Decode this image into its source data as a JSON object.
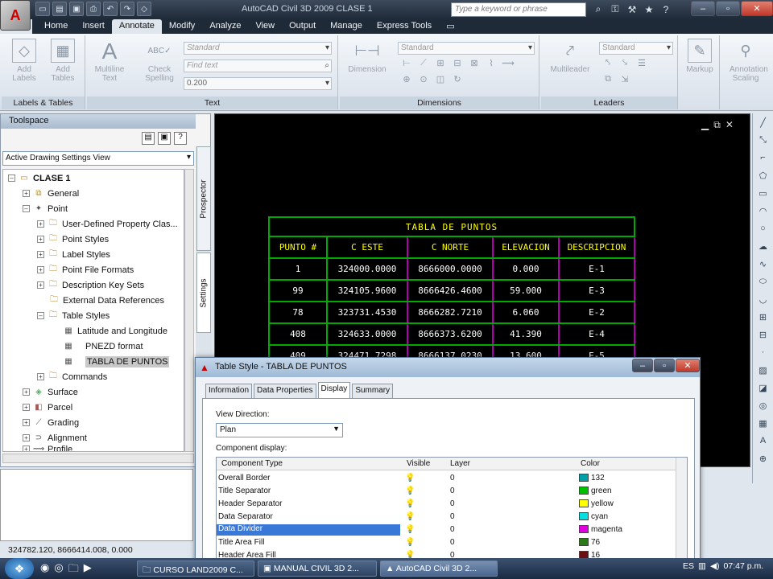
{
  "window": {
    "title": "AutoCAD Civil 3D 2009    CLASE 1",
    "search_placeholder": "Type a keyword or phrase"
  },
  "ribbon": {
    "tabs": [
      "Home",
      "Insert",
      "Annotate",
      "Modify",
      "Analyze",
      "View",
      "Output",
      "Manage",
      "Express Tools"
    ],
    "active_tab": "Annotate",
    "panels": {
      "labels": {
        "title": "Labels & Tables",
        "add_labels": "Add Labels",
        "add_tables": "Add Tables"
      },
      "text": {
        "title": "Text",
        "multiline": "Multiline Text",
        "check_spelling": "Check Spelling",
        "style": "Standard",
        "find_text": "Find text",
        "height": "0.200"
      },
      "dimensions": {
        "title": "Dimensions",
        "dimension": "Dimension",
        "style": "Standard"
      },
      "leaders": {
        "title": "Leaders",
        "multileader": "Multileader",
        "style": "Standard"
      },
      "markup": {
        "title": "Markup"
      },
      "scaling": {
        "title": "Annotation Scaling"
      }
    }
  },
  "toolspace": {
    "title": "Toolspace",
    "view": "Active Drawing Settings View",
    "vtabs": [
      "Prospector",
      "Settings"
    ],
    "tree": [
      {
        "label": "CLASE 1",
        "level": 0
      },
      {
        "label": "General",
        "level": 1
      },
      {
        "label": "Point",
        "level": 1
      },
      {
        "label": "User-Defined Property Clas...",
        "level": 2
      },
      {
        "label": "Point Styles",
        "level": 2
      },
      {
        "label": "Label Styles",
        "level": 2
      },
      {
        "label": "Point File Formats",
        "level": 2
      },
      {
        "label": "Description Key Sets",
        "level": 2
      },
      {
        "label": "External Data References",
        "level": 2
      },
      {
        "label": "Table Styles",
        "level": 2
      },
      {
        "label": "Latitude and Longitude",
        "level": 3
      },
      {
        "label": "PNEZD format",
        "level": 3
      },
      {
        "label": "TABLA DE PUNTOS",
        "level": 3
      },
      {
        "label": "Commands",
        "level": 2
      },
      {
        "label": "Surface",
        "level": 1
      },
      {
        "label": "Parcel",
        "level": 1
      },
      {
        "label": "Grading",
        "level": 1
      },
      {
        "label": "Alignment",
        "level": 1
      },
      {
        "label": "Profile",
        "level": 1
      }
    ]
  },
  "points_table": {
    "title": "TABLA DE PUNTOS",
    "headers": [
      "PUNTO #",
      "C ESTE",
      "C NORTE",
      "ELEVACION",
      "DESCRIPCION"
    ],
    "rows": [
      [
        "1",
        "324000.0000",
        "8666000.0000",
        "0.000",
        "E-1"
      ],
      [
        "99",
        "324105.9600",
        "8666426.4600",
        "59.000",
        "E-3"
      ],
      [
        "78",
        "323731.4530",
        "8666282.7210",
        "6.060",
        "E-2"
      ],
      [
        "408",
        "324633.0000",
        "8666373.6200",
        "41.390",
        "E-4"
      ],
      [
        "409",
        "324471.7298",
        "8666137.0230",
        "13.600",
        "E-5"
      ]
    ]
  },
  "status": {
    "coords": "324782.120, 8666414.008, 0.000"
  },
  "dialog": {
    "title": "Table Style - TABLA DE PUNTOS",
    "tabs": [
      "Information",
      "Data Properties",
      "Display",
      "Summary"
    ],
    "active_tab": "Display",
    "view_direction_label": "View Direction:",
    "view_direction": "Plan",
    "component_display_label": "Component display:",
    "columns": [
      "Component Type",
      "Visible",
      "Layer",
      "Color"
    ],
    "rows": [
      {
        "type": "Overall Border",
        "layer": "0",
        "color": "132",
        "swatch": "#00a0a8"
      },
      {
        "type": "Title Separator",
        "layer": "0",
        "color": "green",
        "swatch": "#00c000"
      },
      {
        "type": "Header Separator",
        "layer": "0",
        "color": "yellow",
        "swatch": "#ffff00"
      },
      {
        "type": "Data Separator",
        "layer": "0",
        "color": "cyan",
        "swatch": "#00e0e0"
      },
      {
        "type": "Data Divider",
        "layer": "0",
        "color": "magenta",
        "swatch": "#e000e0",
        "selected": true
      },
      {
        "type": "Title Area Fill",
        "layer": "0",
        "color": "76",
        "swatch": "#2a7a18"
      },
      {
        "type": "Header Area Fill",
        "layer": "0",
        "color": "16",
        "swatch": "#6a1010"
      }
    ]
  },
  "taskbar": {
    "items": [
      "CURSO LAND2009 C...",
      "MANUAL CIVIL 3D 2...",
      "AutoCAD Civil 3D 2..."
    ],
    "lang": "ES",
    "time": "07:47 p.m."
  }
}
